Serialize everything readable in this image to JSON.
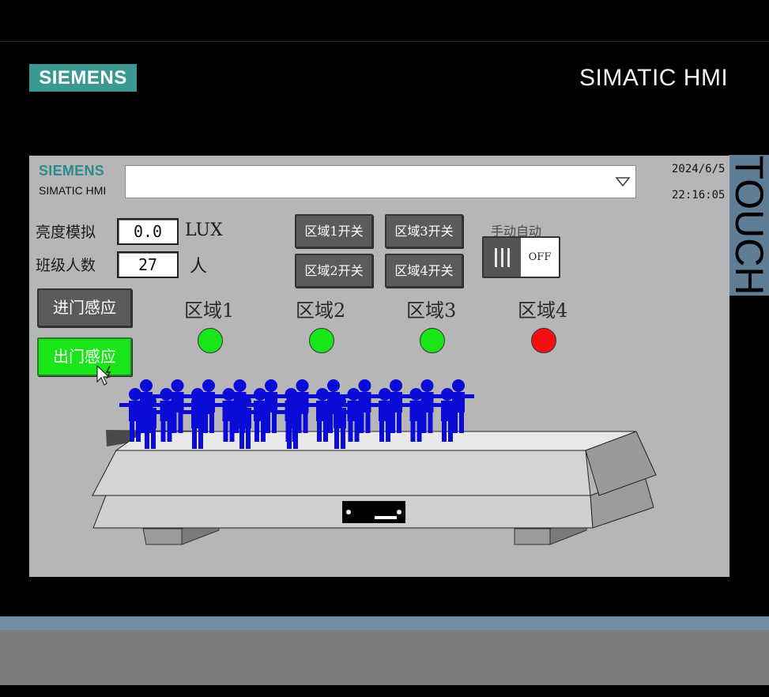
{
  "frame": {
    "brand": "SIEMENS",
    "product": "SIMATIC HMI",
    "side_tab": "TOUCH"
  },
  "screen": {
    "brand": "SIEMENS",
    "product": "SIMATIC HMI",
    "date": "2024/6/5",
    "time": "22:16:05",
    "alarm_value": ""
  },
  "brightness": {
    "label": "亮度模拟",
    "value": "0.0",
    "unit": "LUX"
  },
  "students": {
    "label": "班级人数",
    "value": "27",
    "unit": "人"
  },
  "buttons": {
    "zone1": "区域1开关",
    "zone2": "区域2开关",
    "zone3": "区域3开关",
    "zone4": "区域4开关",
    "enter": "进门感应",
    "exit": "出门感应"
  },
  "mode": {
    "label": "手动自动",
    "state": "OFF"
  },
  "zones": [
    {
      "label": "区域1",
      "lamp_color": "#19e619"
    },
    {
      "label": "区域2",
      "lamp_color": "#19e619"
    },
    {
      "label": "区域3",
      "lamp_color": "#19e619"
    },
    {
      "label": "区域4",
      "lamp_color": "#f01010"
    }
  ],
  "colors": {
    "screen_bg": "#b6b6b8",
    "brand_teal": "#3a9a91",
    "active_button": "#19e619",
    "person_figure": "#0b0bd8"
  },
  "people_count": 27
}
